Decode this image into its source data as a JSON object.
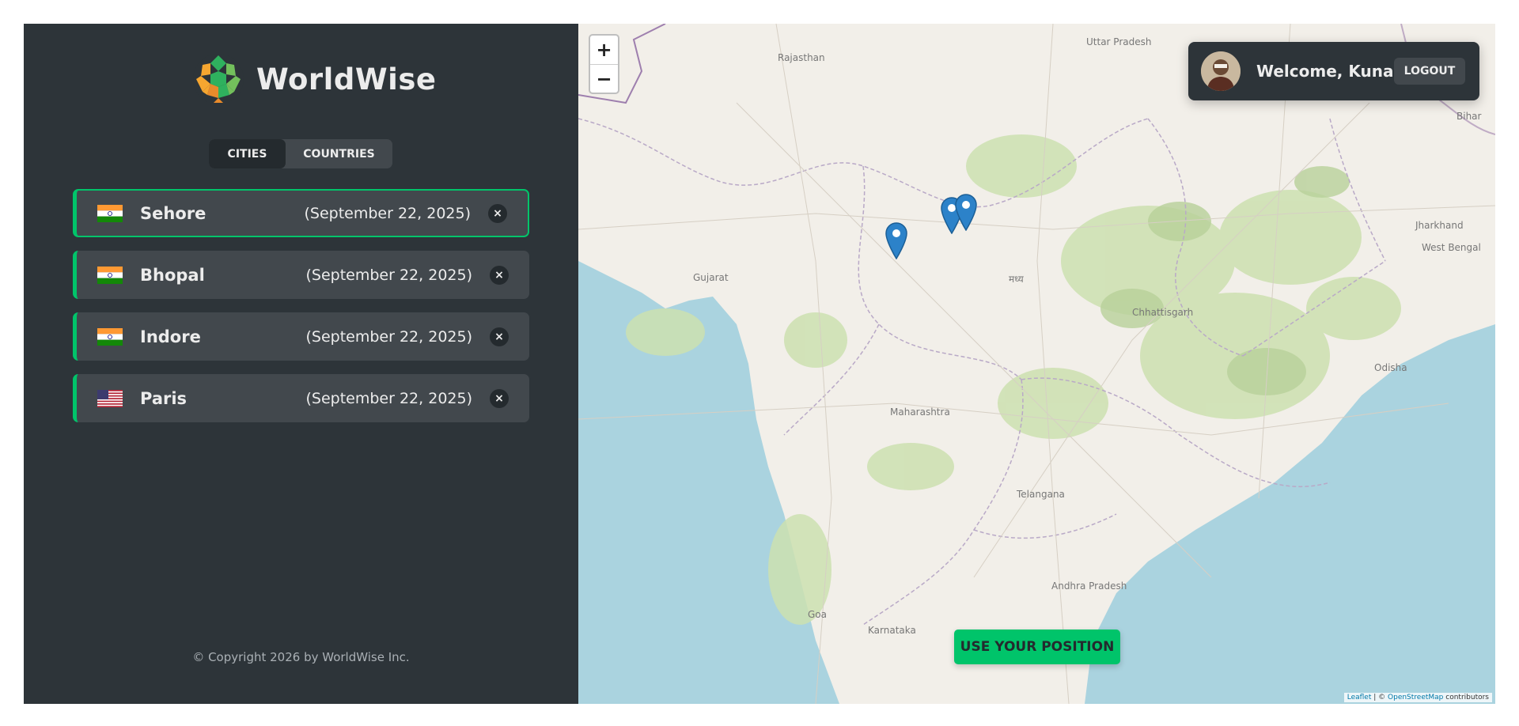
{
  "brand": {
    "name": "WorldWise"
  },
  "tabs": [
    {
      "label": "CITIES"
    },
    {
      "label": "COUNTRIES"
    }
  ],
  "cities": [
    {
      "name": "Sehore",
      "date": "(September 22, 2025)",
      "flag": "india-flag"
    },
    {
      "name": "Bhopal",
      "date": "(September 22, 2025)",
      "flag": "india-flag"
    },
    {
      "name": "Indore",
      "date": "(September 22, 2025)",
      "flag": "india-flag"
    },
    {
      "name": "Paris",
      "date": "(September 22, 2025)",
      "flag": "us-flag"
    }
  ],
  "delete_label": "×",
  "footer": {
    "copyright": "© Copyright 2026 by WorldWise Inc."
  },
  "user": {
    "welcome": "Welcome, Kunal",
    "logout_label": "LOGOUT"
  },
  "map": {
    "zoom_in": "+",
    "zoom_out": "−",
    "use_position_label": "USE YOUR POSITION",
    "labels": [
      "Uttar Pradesh",
      "Rajasthan",
      "Bihar",
      "Jharkhand",
      "West Bengal",
      "Gujarat",
      "Chhattisgarh",
      "Odisha",
      "Maharashtra",
      "Telangana",
      "Andhra Pradesh",
      "Karnataka",
      "Goa",
      "मध्य"
    ],
    "attribution": {
      "leaflet": "Leaflet",
      "sep": " | © ",
      "osm": "OpenStreetMap",
      "suffix": " contributors"
    }
  },
  "colors": {
    "accent": "#00c46a",
    "sidebar": "#2d3439",
    "card": "#42484d",
    "sea": "#aad3df",
    "land": "#f2efe9"
  }
}
